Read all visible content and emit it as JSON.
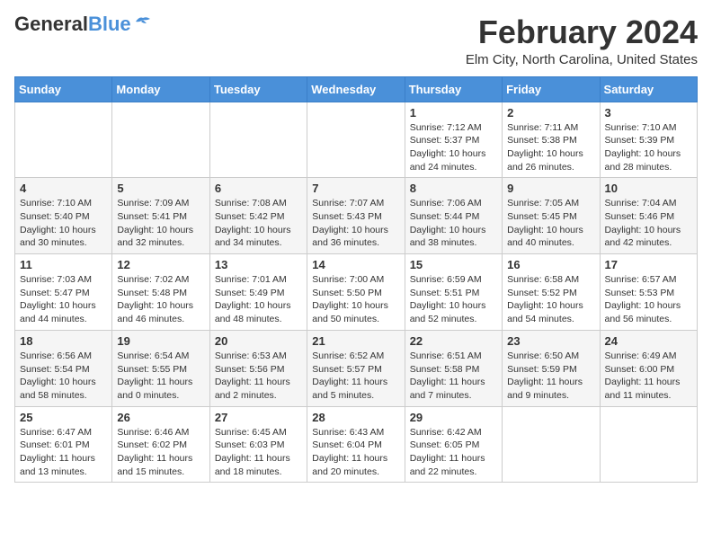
{
  "header": {
    "logo_general": "General",
    "logo_blue": "Blue",
    "month": "February 2024",
    "location": "Elm City, North Carolina, United States"
  },
  "days_of_week": [
    "Sunday",
    "Monday",
    "Tuesday",
    "Wednesday",
    "Thursday",
    "Friday",
    "Saturday"
  ],
  "weeks": [
    [
      {
        "day": "",
        "info": ""
      },
      {
        "day": "",
        "info": ""
      },
      {
        "day": "",
        "info": ""
      },
      {
        "day": "",
        "info": ""
      },
      {
        "day": "1",
        "info": "Sunrise: 7:12 AM\nSunset: 5:37 PM\nDaylight: 10 hours\nand 24 minutes."
      },
      {
        "day": "2",
        "info": "Sunrise: 7:11 AM\nSunset: 5:38 PM\nDaylight: 10 hours\nand 26 minutes."
      },
      {
        "day": "3",
        "info": "Sunrise: 7:10 AM\nSunset: 5:39 PM\nDaylight: 10 hours\nand 28 minutes."
      }
    ],
    [
      {
        "day": "4",
        "info": "Sunrise: 7:10 AM\nSunset: 5:40 PM\nDaylight: 10 hours\nand 30 minutes."
      },
      {
        "day": "5",
        "info": "Sunrise: 7:09 AM\nSunset: 5:41 PM\nDaylight: 10 hours\nand 32 minutes."
      },
      {
        "day": "6",
        "info": "Sunrise: 7:08 AM\nSunset: 5:42 PM\nDaylight: 10 hours\nand 34 minutes."
      },
      {
        "day": "7",
        "info": "Sunrise: 7:07 AM\nSunset: 5:43 PM\nDaylight: 10 hours\nand 36 minutes."
      },
      {
        "day": "8",
        "info": "Sunrise: 7:06 AM\nSunset: 5:44 PM\nDaylight: 10 hours\nand 38 minutes."
      },
      {
        "day": "9",
        "info": "Sunrise: 7:05 AM\nSunset: 5:45 PM\nDaylight: 10 hours\nand 40 minutes."
      },
      {
        "day": "10",
        "info": "Sunrise: 7:04 AM\nSunset: 5:46 PM\nDaylight: 10 hours\nand 42 minutes."
      }
    ],
    [
      {
        "day": "11",
        "info": "Sunrise: 7:03 AM\nSunset: 5:47 PM\nDaylight: 10 hours\nand 44 minutes."
      },
      {
        "day": "12",
        "info": "Sunrise: 7:02 AM\nSunset: 5:48 PM\nDaylight: 10 hours\nand 46 minutes."
      },
      {
        "day": "13",
        "info": "Sunrise: 7:01 AM\nSunset: 5:49 PM\nDaylight: 10 hours\nand 48 minutes."
      },
      {
        "day": "14",
        "info": "Sunrise: 7:00 AM\nSunset: 5:50 PM\nDaylight: 10 hours\nand 50 minutes."
      },
      {
        "day": "15",
        "info": "Sunrise: 6:59 AM\nSunset: 5:51 PM\nDaylight: 10 hours\nand 52 minutes."
      },
      {
        "day": "16",
        "info": "Sunrise: 6:58 AM\nSunset: 5:52 PM\nDaylight: 10 hours\nand 54 minutes."
      },
      {
        "day": "17",
        "info": "Sunrise: 6:57 AM\nSunset: 5:53 PM\nDaylight: 10 hours\nand 56 minutes."
      }
    ],
    [
      {
        "day": "18",
        "info": "Sunrise: 6:56 AM\nSunset: 5:54 PM\nDaylight: 10 hours\nand 58 minutes."
      },
      {
        "day": "19",
        "info": "Sunrise: 6:54 AM\nSunset: 5:55 PM\nDaylight: 11 hours\nand 0 minutes."
      },
      {
        "day": "20",
        "info": "Sunrise: 6:53 AM\nSunset: 5:56 PM\nDaylight: 11 hours\nand 2 minutes."
      },
      {
        "day": "21",
        "info": "Sunrise: 6:52 AM\nSunset: 5:57 PM\nDaylight: 11 hours\nand 5 minutes."
      },
      {
        "day": "22",
        "info": "Sunrise: 6:51 AM\nSunset: 5:58 PM\nDaylight: 11 hours\nand 7 minutes."
      },
      {
        "day": "23",
        "info": "Sunrise: 6:50 AM\nSunset: 5:59 PM\nDaylight: 11 hours\nand 9 minutes."
      },
      {
        "day": "24",
        "info": "Sunrise: 6:49 AM\nSunset: 6:00 PM\nDaylight: 11 hours\nand 11 minutes."
      }
    ],
    [
      {
        "day": "25",
        "info": "Sunrise: 6:47 AM\nSunset: 6:01 PM\nDaylight: 11 hours\nand 13 minutes."
      },
      {
        "day": "26",
        "info": "Sunrise: 6:46 AM\nSunset: 6:02 PM\nDaylight: 11 hours\nand 15 minutes."
      },
      {
        "day": "27",
        "info": "Sunrise: 6:45 AM\nSunset: 6:03 PM\nDaylight: 11 hours\nand 18 minutes."
      },
      {
        "day": "28",
        "info": "Sunrise: 6:43 AM\nSunset: 6:04 PM\nDaylight: 11 hours\nand 20 minutes."
      },
      {
        "day": "29",
        "info": "Sunrise: 6:42 AM\nSunset: 6:05 PM\nDaylight: 11 hours\nand 22 minutes."
      },
      {
        "day": "",
        "info": ""
      },
      {
        "day": "",
        "info": ""
      }
    ]
  ]
}
